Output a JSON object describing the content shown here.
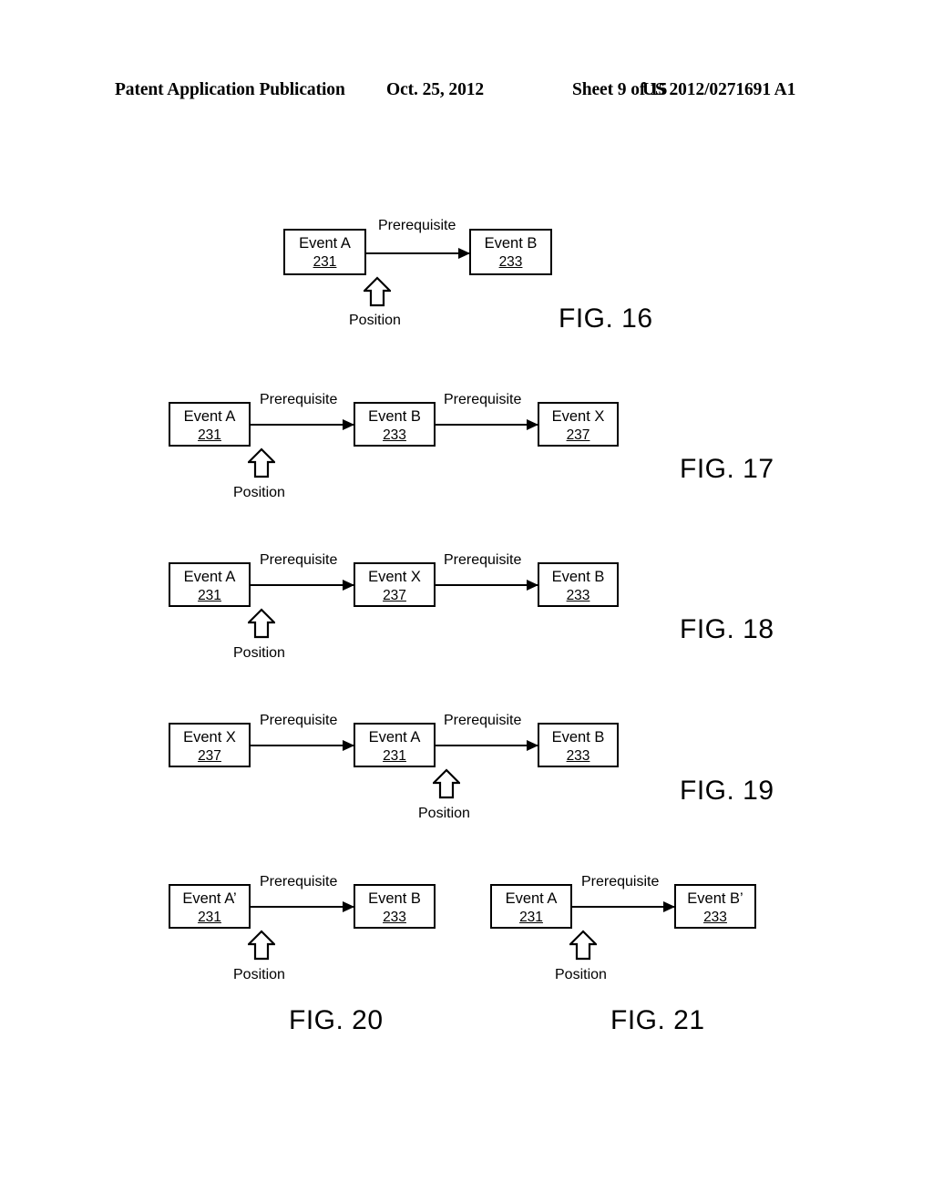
{
  "header": {
    "publication": "Patent Application Publication",
    "date": "Oct. 25, 2012",
    "sheet": "Sheet 9 of 15",
    "patent_number": "US 2012/0271691 A1"
  },
  "common": {
    "edge_label": "Prerequisite",
    "position_label": "Position"
  },
  "figures": [
    {
      "caption": "FIG. 16",
      "nodes": [
        {
          "label": "Event A",
          "ref": "231"
        },
        {
          "label": "Event B",
          "ref": "233"
        }
      ],
      "edges": [
        {
          "label": "Prerequisite"
        }
      ],
      "position_marker": {
        "label": "Position",
        "attached_to": "Event A"
      }
    },
    {
      "caption": "FIG. 17",
      "nodes": [
        {
          "label": "Event A",
          "ref": "231"
        },
        {
          "label": "Event B",
          "ref": "233"
        },
        {
          "label": "Event X",
          "ref": "237"
        }
      ],
      "edges": [
        {
          "label": "Prerequisite"
        },
        {
          "label": "Prerequisite"
        }
      ],
      "position_marker": {
        "label": "Position",
        "attached_to": "Event A"
      }
    },
    {
      "caption": "FIG. 18",
      "nodes": [
        {
          "label": "Event A",
          "ref": "231"
        },
        {
          "label": "Event X",
          "ref": "237"
        },
        {
          "label": "Event B",
          "ref": "233"
        }
      ],
      "edges": [
        {
          "label": "Prerequisite"
        },
        {
          "label": "Prerequisite"
        }
      ],
      "position_marker": {
        "label": "Position",
        "attached_to": "Event A"
      }
    },
    {
      "caption": "FIG. 19",
      "nodes": [
        {
          "label": "Event X",
          "ref": "237"
        },
        {
          "label": "Event A",
          "ref": "231"
        },
        {
          "label": "Event B",
          "ref": "233"
        }
      ],
      "edges": [
        {
          "label": "Prerequisite"
        },
        {
          "label": "Prerequisite"
        }
      ],
      "position_marker": {
        "label": "Position",
        "attached_to": "Event A"
      }
    },
    {
      "caption": "FIG. 20",
      "nodes": [
        {
          "label": "Event A’",
          "ref": "231"
        },
        {
          "label": "Event B",
          "ref": "233"
        }
      ],
      "edges": [
        {
          "label": "Prerequisite"
        }
      ],
      "position_marker": {
        "label": "Position",
        "attached_to": "Event A’"
      }
    },
    {
      "caption": "FIG. 21",
      "nodes": [
        {
          "label": "Event A",
          "ref": "231"
        },
        {
          "label": "Event B’",
          "ref": "233"
        }
      ],
      "edges": [
        {
          "label": "Prerequisite"
        }
      ],
      "position_marker": {
        "label": "Position",
        "attached_to": "Event A"
      }
    }
  ]
}
